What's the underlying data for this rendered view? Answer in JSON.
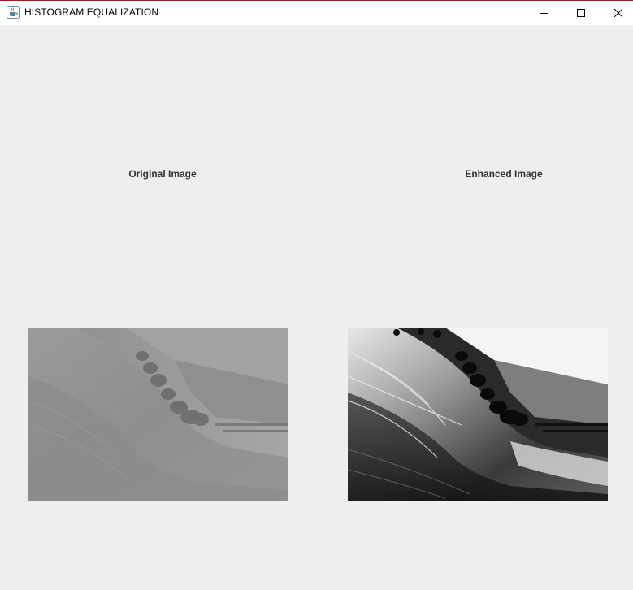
{
  "window": {
    "title": "HISTOGRAM EQUALIZATION",
    "app_icon": "java-cup-icon",
    "controls": {
      "minimize_icon": "minimize-icon",
      "maximize_icon": "maximize-icon",
      "close_icon": "close-icon"
    }
  },
  "panels": {
    "original": {
      "label": "Original Image",
      "image_description": "grayscale hillside landscape, low contrast"
    },
    "enhanced": {
      "label": "Enhanced Image",
      "image_description": "grayscale hillside landscape, high contrast after equalization"
    }
  },
  "colors": {
    "background": "#eeeeee",
    "titlebar": "#ffffff",
    "caption_text": "#333333",
    "window_border_accent": "#9c1c20"
  }
}
